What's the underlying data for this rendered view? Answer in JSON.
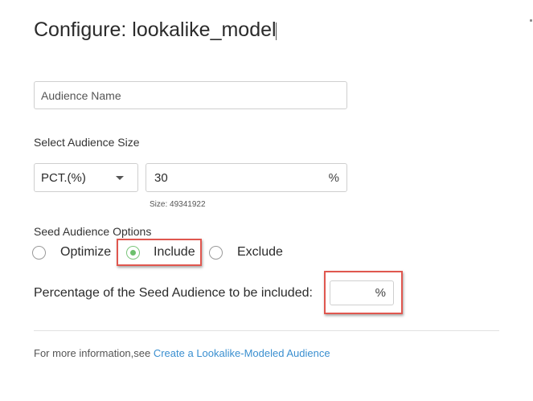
{
  "dialog": {
    "title": "Configure: lookalike_model"
  },
  "audience_name": {
    "placeholder": "Audience Name",
    "value": ""
  },
  "audience_size": {
    "label": "Select Audience Size",
    "select_value": "PCT.(%)",
    "value": "30",
    "unit": "%",
    "size_hint": "Size: 49341922"
  },
  "seed_options": {
    "label": "Seed Audience Options",
    "options": [
      {
        "label": "Optimize",
        "checked": false
      },
      {
        "label": "Include",
        "checked": true
      },
      {
        "label": "Exclude",
        "checked": false
      }
    ]
  },
  "seed_percentage": {
    "label": "Percentage of the Seed Audience to be included:",
    "value": "",
    "unit": "%"
  },
  "footer": {
    "text": "For more information,see ",
    "link_text": "Create a Lookalike-Modeled Audience"
  },
  "colors": {
    "accent_green": "#6cc06c",
    "highlight_red": "#e0574f",
    "link_blue": "#3a8fd0"
  }
}
